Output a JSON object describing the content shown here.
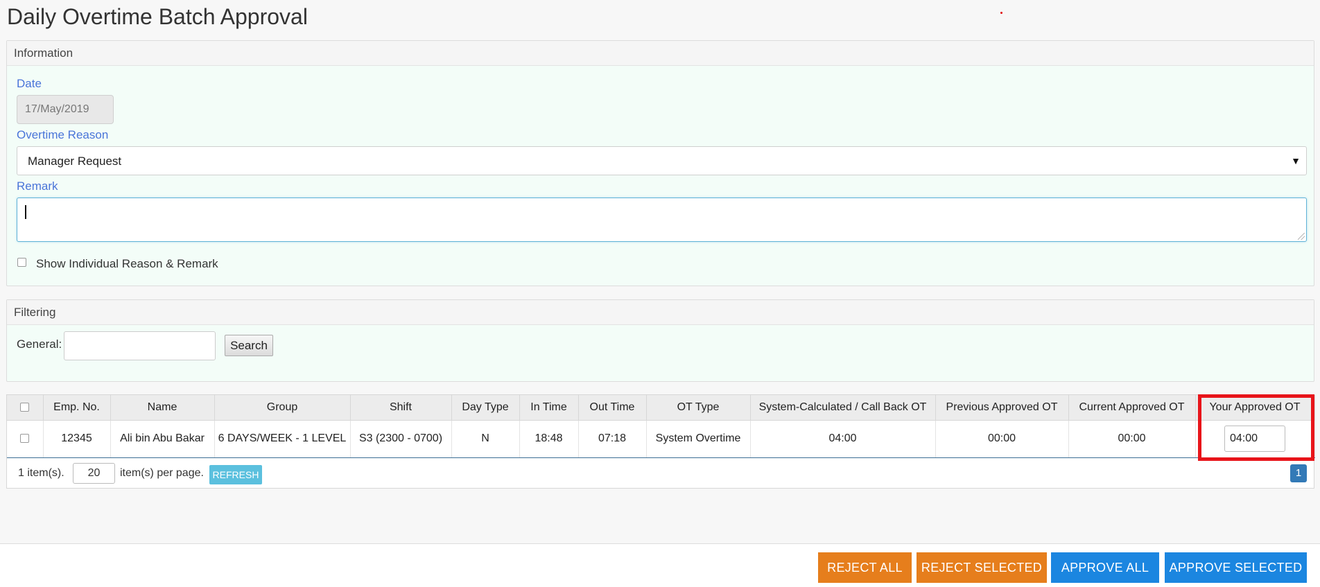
{
  "page": {
    "title": "Daily Overtime Batch Approval"
  },
  "information": {
    "heading": "Information",
    "date_label": "Date",
    "date_value": "17/May/2019",
    "reason_label": "Overtime Reason",
    "reason_value": "Manager Request",
    "remark_label": "Remark",
    "remark_value": "",
    "show_individual_label": "Show Individual Reason & Remark"
  },
  "filtering": {
    "heading": "Filtering",
    "general_label": "General:",
    "general_value": "",
    "search_label": "Search"
  },
  "table": {
    "columns": [
      "",
      "Emp. No.",
      "Name",
      "Group",
      "Shift",
      "Day Type",
      "In Time",
      "Out Time",
      "OT Type",
      "System-Calculated / Call Back OT",
      "Previous Approved OT",
      "Current Approved OT",
      "Your Approved OT"
    ],
    "rows": [
      {
        "emp_no": "12345",
        "name": "Ali bin Abu Bakar",
        "group": "6 DAYS/WEEK - 1 LEVEL",
        "shift": "S3 (2300 - 0700)",
        "day_type": "N",
        "in_time": "18:48",
        "out_time": "07:18",
        "ot_type": "System Overtime",
        "system_ot": "04:00",
        "previous_ot": "00:00",
        "current_ot": "00:00",
        "your_ot": "04:00"
      }
    ]
  },
  "pager": {
    "count_text": "1 item(s).",
    "page_size": "20",
    "per_page_text": "item(s) per page.",
    "refresh_label": "REFRESH",
    "current_page": "1"
  },
  "actions": {
    "reject_all": "REJECT ALL",
    "reject_selected": "REJECT SELECTED",
    "approve_all": "APPROVE ALL",
    "approve_selected": "APPROVE SELECTED"
  },
  "colors": {
    "reject": "#e67e1c",
    "approve": "#1b86e0",
    "highlight": "#e8141a",
    "label_blue": "#4a74d9"
  }
}
